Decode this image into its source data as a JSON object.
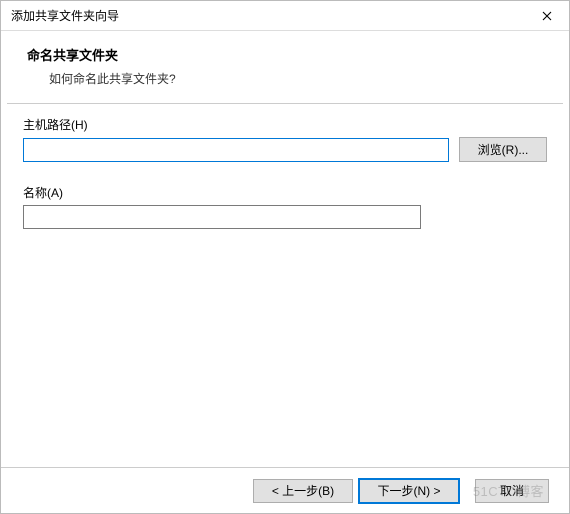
{
  "window": {
    "title": "添加共享文件夹向导"
  },
  "header": {
    "title": "命名共享文件夹",
    "subtitle": "如何命名此共享文件夹?"
  },
  "fields": {
    "host_path": {
      "label": "主机路径(H)",
      "value": "",
      "browse_label": "浏览(R)..."
    },
    "name": {
      "label": "名称(A)",
      "value": ""
    }
  },
  "footer": {
    "back": "< 上一步(B)",
    "next": "下一步(N) >",
    "cancel": "取消"
  },
  "watermark": "51CTO博客"
}
